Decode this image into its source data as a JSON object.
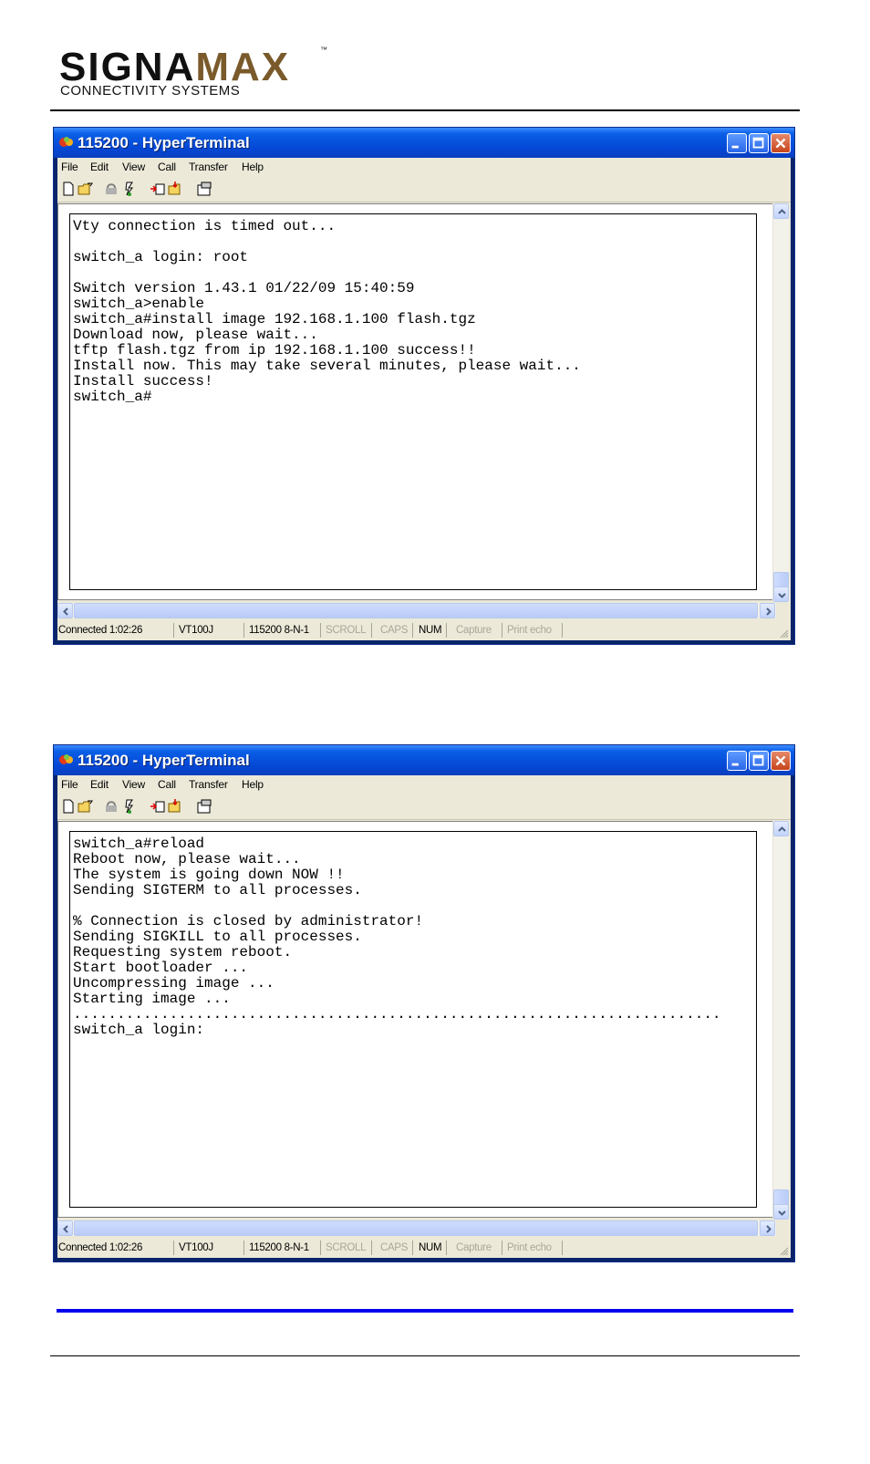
{
  "header": {
    "logo_main_1": "SIGNA",
    "logo_main_2": "MAX",
    "logo_tm": "™",
    "logo_sub": "CONNECTIVITY SYSTEMS"
  },
  "windows": [
    {
      "title": "115200 - HyperTerminal",
      "menu": [
        "File",
        "Edit",
        "View",
        "Call",
        "Transfer",
        "Help"
      ],
      "terminal": "Vty connection is timed out...\n\nswitch_a login: root\n\nSwitch version 1.43.1 01/22/09 15:40:59\nswitch_a>enable\nswitch_a#install image 192.168.1.100 flash.tgz\nDownload now, please wait...\ntftp flash.tgz from ip 192.168.1.100 success!!\nInstall now. This may take several minutes, please wait...\nInstall success!\nswitch_a#",
      "status": {
        "connected": "Connected 1:02:26",
        "emulation": "VT100J",
        "settings": "115200 8-N-1",
        "scroll": "SCROLL",
        "caps": "CAPS",
        "num": "NUM",
        "capture": "Capture",
        "print_echo": "Print echo"
      }
    },
    {
      "title": "115200 - HyperTerminal",
      "menu": [
        "File",
        "Edit",
        "View",
        "Call",
        "Transfer",
        "Help"
      ],
      "terminal": "switch_a#reload\nReboot now, please wait...\nThe system is going down NOW !!\nSending SIGTERM to all processes.\n\n% Connection is closed by administrator!\nSending SIGKILL to all processes.\nRequesting system reboot.\nStart bootloader ...\nUncompressing image ...\nStarting image ...\n..........................................................................\nswitch_a login:",
      "status": {
        "connected": "Connected 1:02:26",
        "emulation": "VT100J",
        "settings": "115200 8-N-1",
        "scroll": "SCROLL",
        "caps": "CAPS",
        "num": "NUM",
        "capture": "Capture",
        "print_echo": "Print echo"
      }
    }
  ],
  "colors": {
    "titlebar": "#0447d5",
    "separator": "#0000ee",
    "logo_accent": "#7a5a2b"
  }
}
